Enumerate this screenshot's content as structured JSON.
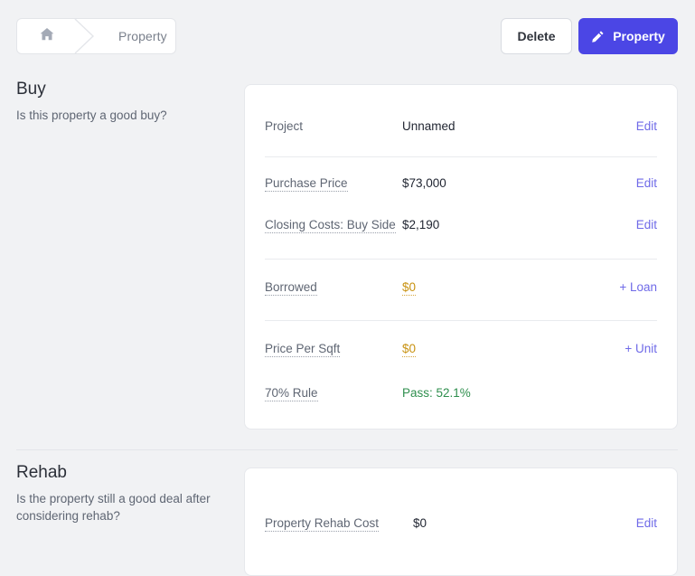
{
  "breadcrumb": {
    "home_icon": "home-icon",
    "current": "Property"
  },
  "toolbar": {
    "delete_label": "Delete",
    "property_label": "Property",
    "property_icon": "pencil-icon"
  },
  "colors": {
    "accent": "#4b46e5",
    "link": "#6f6ae8",
    "warning": "#c89211",
    "success": "#2f8f4e",
    "page_bg": "#f1f2f4",
    "card_bg": "#ffffff"
  },
  "sections": [
    {
      "title": "Buy",
      "subtitle": "Is this property a good buy?",
      "groups": [
        {
          "rows": [
            {
              "label": "Project",
              "hinted": false,
              "value": "Unnamed",
              "value_style": "default",
              "action": "Edit"
            }
          ]
        },
        {
          "rows": [
            {
              "label": "Purchase Price",
              "hinted": true,
              "value": "$73,000",
              "value_style": "default",
              "action": "Edit"
            },
            {
              "label": "Closing Costs: Buy Side",
              "hinted": true,
              "value": "$2,190",
              "value_style": "default",
              "action": "Edit"
            }
          ]
        },
        {
          "rows": [
            {
              "label": "Borrowed",
              "hinted": true,
              "value": "$0",
              "value_style": "amber",
              "action": "+ Loan"
            }
          ]
        },
        {
          "rows": [
            {
              "label": "Price Per Sqft",
              "hinted": true,
              "value": "$0",
              "value_style": "amber",
              "action": "+ Unit"
            },
            {
              "label": "70% Rule",
              "hinted": true,
              "value": "Pass: 52.1%",
              "value_style": "green",
              "action": ""
            }
          ]
        }
      ]
    },
    {
      "title": "Rehab",
      "subtitle": "Is the property still a good deal after considering rehab?",
      "groups": [
        {
          "rows": [
            {
              "label": "Property Rehab Cost",
              "hinted": true,
              "value": "$0",
              "value_style": "default",
              "action": "Edit"
            }
          ]
        }
      ]
    }
  ]
}
